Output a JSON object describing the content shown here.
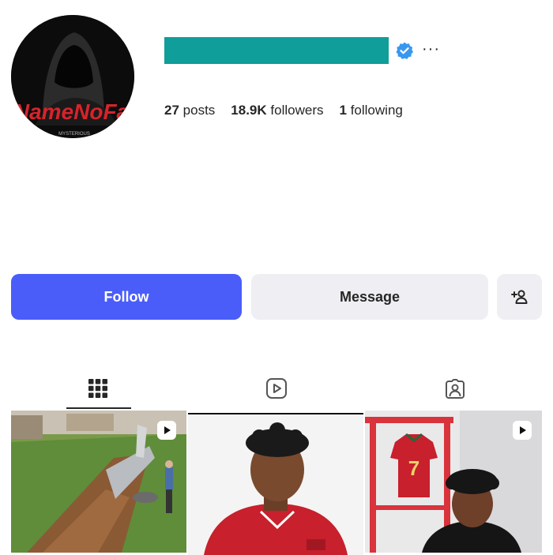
{
  "profile": {
    "verified_icon": "verified-badge-icon",
    "more_icon": "more-horizontal-icon",
    "more_label": "···",
    "avatar_text": "NameNoFa",
    "avatar_caption": "MYSTERIOUS",
    "brand_colors": {
      "username_bar": "#0f9e9a",
      "verified": "#3897f0"
    }
  },
  "stats": {
    "posts_count": "27",
    "posts_label": "posts",
    "followers_count": "18.9K",
    "followers_label": "followers",
    "following_count": "1",
    "following_label": "following"
  },
  "actions": {
    "follow_label": "Follow",
    "message_label": "Message",
    "suggest_icon": "add-person-icon",
    "follow_color": "#4a5df9"
  },
  "tabs": [
    {
      "name": "posts",
      "icon": "grid-icon",
      "active": true
    },
    {
      "name": "reels",
      "icon": "reels-icon",
      "active": false
    },
    {
      "name": "tagged",
      "icon": "tagged-icon",
      "active": false
    }
  ],
  "grid": [
    {
      "type": "reel",
      "desc": "yard-trench-tank"
    },
    {
      "type": "post",
      "desc": "person-red-jersey"
    },
    {
      "type": "reel",
      "desc": "jersey-display-number-7",
      "jersey_number": "7"
    }
  ]
}
